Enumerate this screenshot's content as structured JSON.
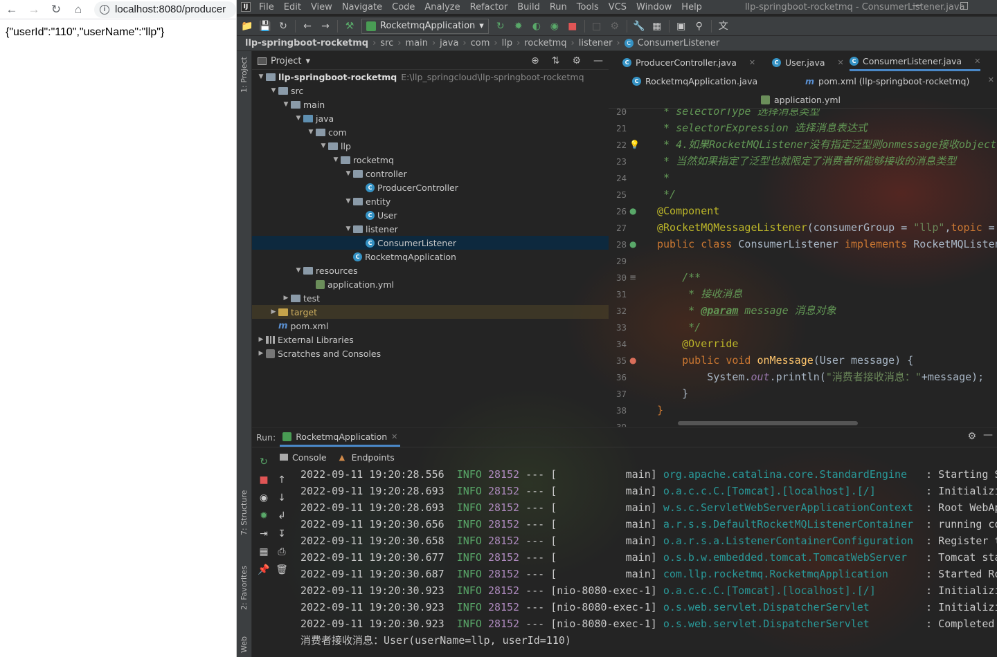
{
  "browser": {
    "url": "localhost:8080/producer",
    "body": "{\"userId\":\"110\",\"userName\":\"llp\"}"
  },
  "ide": {
    "window_title": "llp-springboot-rocketmq - ConsumerListener.java",
    "menu": [
      "File",
      "Edit",
      "View",
      "Navigate",
      "Code",
      "Analyze",
      "Refactor",
      "Build",
      "Run",
      "Tools",
      "VCS",
      "Window",
      "Help"
    ],
    "run_config": "RocketmqApplication",
    "breadcrumbs": [
      "llp-springboot-rocketmq",
      "src",
      "main",
      "java",
      "com",
      "llp",
      "rocketmq",
      "listener",
      "ConsumerListener"
    ],
    "side_labels": {
      "project": "1: Project",
      "structure": "7: Structure",
      "favorites": "2: Favorites",
      "web": "Web"
    },
    "project_panel": {
      "title": "Project",
      "root_path": "E:\\llp_springcloud\\llp-springboot-rocketmq",
      "tree": [
        {
          "label": "llp-springboot-rocketmq",
          "depth": 0,
          "type": "module",
          "expanded": true
        },
        {
          "label": "src",
          "depth": 1,
          "type": "folder",
          "expanded": true
        },
        {
          "label": "main",
          "depth": 2,
          "type": "folder",
          "expanded": true
        },
        {
          "label": "java",
          "depth": 3,
          "type": "srcfolder",
          "expanded": true
        },
        {
          "label": "com",
          "depth": 4,
          "type": "folder",
          "expanded": true
        },
        {
          "label": "llp",
          "depth": 5,
          "type": "folder",
          "expanded": true
        },
        {
          "label": "rocketmq",
          "depth": 6,
          "type": "folder",
          "expanded": true
        },
        {
          "label": "controller",
          "depth": 7,
          "type": "folder",
          "expanded": true
        },
        {
          "label": "ProducerController",
          "depth": 8,
          "type": "class"
        },
        {
          "label": "entity",
          "depth": 7,
          "type": "folder",
          "expanded": true
        },
        {
          "label": "User",
          "depth": 8,
          "type": "class"
        },
        {
          "label": "listener",
          "depth": 7,
          "type": "folder",
          "expanded": true
        },
        {
          "label": "ConsumerListener",
          "depth": 8,
          "type": "class",
          "selected": true
        },
        {
          "label": "RocketmqApplication",
          "depth": 7,
          "type": "appclass"
        },
        {
          "label": "resources",
          "depth": 3,
          "type": "resfolder",
          "expanded": true
        },
        {
          "label": "application.yml",
          "depth": 4,
          "type": "yml"
        },
        {
          "label": "test",
          "depth": 2,
          "type": "folder",
          "expanded": false
        },
        {
          "label": "target",
          "depth": 1,
          "type": "target",
          "expanded": false,
          "highlight": true
        },
        {
          "label": "pom.xml",
          "depth": 1,
          "type": "maven"
        },
        {
          "label": "External Libraries",
          "depth": 0,
          "type": "lib",
          "expanded": false
        },
        {
          "label": "Scratches and Consoles",
          "depth": 0,
          "type": "scratch",
          "expanded": false
        }
      ]
    },
    "tabs": [
      {
        "label": "ProducerController.java",
        "icon": "class"
      },
      {
        "label": "User.java",
        "icon": "class"
      },
      {
        "label": "ConsumerListener.java",
        "icon": "class",
        "active": true
      },
      {
        "label": "RocketmqApplication.java",
        "icon": "class"
      },
      {
        "label": "pom.xml (llp-springboot-rocketmq)",
        "icon": "maven"
      },
      {
        "label": "application.yml",
        "icon": "yml"
      }
    ],
    "editor": {
      "line_numbers": [
        "20",
        "21",
        "22",
        "23",
        "24",
        "25",
        "26",
        "27",
        "28",
        "29",
        "30",
        "31",
        "32",
        "33",
        "34",
        "35",
        "36",
        "37",
        "38",
        "39"
      ],
      "lines": [
        {
          "t": "c",
          "parts": [
            [
              "cm",
              " * selectorType 选择消息类型"
            ]
          ]
        },
        {
          "t": "c",
          "parts": [
            [
              "cm",
              " * selectorExpression 选择消息表达式"
            ]
          ]
        },
        {
          "t": "c",
          "parts": [
            [
              "cm",
              " * 4.如果RocketMQListener没有指定泛型则onmessage接收object"
            ]
          ]
        },
        {
          "t": "c",
          "parts": [
            [
              "cm",
              " * 当然如果指定了泛型也就限定了消费者所能够接收的消息类型"
            ]
          ]
        },
        {
          "t": "c",
          "parts": [
            [
              "cm",
              " *"
            ]
          ]
        },
        {
          "t": "c",
          "parts": [
            [
              "cm",
              " */"
            ]
          ]
        },
        {
          "t": "c",
          "parts": [
            [
              "ann",
              "@Component"
            ]
          ]
        },
        {
          "t": "c",
          "parts": [
            [
              "ann",
              "@RocketMQMessageListener"
            ],
            [
              "",
              "(consumerGroup = "
            ],
            [
              "str",
              "\"llp\""
            ],
            [
              "",
              ","
            ],
            [
              "kw",
              "topic"
            ],
            [
              "",
              " ="
            ]
          ]
        },
        {
          "t": "c",
          "parts": [
            [
              "kw",
              "public class "
            ],
            [
              "",
              "ConsumerListener "
            ],
            [
              "kw",
              "implements "
            ],
            [
              "",
              "RocketMQListen"
            ]
          ]
        },
        {
          "t": "c",
          "parts": [
            [
              "",
              ""
            ]
          ]
        },
        {
          "t": "c",
          "parts": [
            [
              "cm",
              "    /**"
            ]
          ]
        },
        {
          "t": "c",
          "parts": [
            [
              "cm",
              "     * 接收消息"
            ]
          ]
        },
        {
          "t": "c",
          "parts": [
            [
              "cm",
              "     * "
            ],
            [
              "tag",
              "@param"
            ],
            [
              "cm",
              " message 消息对象"
            ]
          ]
        },
        {
          "t": "c",
          "parts": [
            [
              "cm",
              "     */"
            ]
          ]
        },
        {
          "t": "c",
          "parts": [
            [
              "ann",
              "    @Override"
            ]
          ]
        },
        {
          "t": "c",
          "parts": [
            [
              "kw",
              "    public void "
            ],
            [
              "fn",
              "onMessage"
            ],
            [
              "",
              "(User message) {"
            ]
          ]
        },
        {
          "t": "c",
          "parts": [
            [
              "",
              "        System."
            ],
            [
              "st",
              "out"
            ],
            [
              "",
              ".println("
            ],
            [
              "str",
              "\"消费者接收消息：\""
            ],
            [
              "",
              "+message);"
            ]
          ]
        },
        {
          "t": "c",
          "parts": [
            [
              "",
              "    }"
            ]
          ]
        },
        {
          "t": "c",
          "parts": [
            [
              "kw",
              "}"
            ]
          ]
        },
        {
          "t": "c",
          "parts": [
            [
              "",
              ""
            ]
          ]
        }
      ]
    },
    "run": {
      "label": "Run:",
      "tab": "RocketmqApplication",
      "subtabs": [
        "Console",
        "Endpoints"
      ],
      "logs": [
        {
          "ts": "2022-09-11 19:20:28.556",
          "lvl": "INFO",
          "pid": "28152",
          "sep": "---",
          "thread": "[           main]",
          "cls": "org.apache.catalina.core.StandardEngine  ",
          "msg": ": Starting Se"
        },
        {
          "ts": "2022-09-11 19:20:28.693",
          "lvl": "INFO",
          "pid": "28152",
          "sep": "---",
          "thread": "[           main]",
          "cls": "o.a.c.c.C.[Tomcat].[localhost].[/]       ",
          "msg": ": Initializin"
        },
        {
          "ts": "2022-09-11 19:20:28.693",
          "lvl": "INFO",
          "pid": "28152",
          "sep": "---",
          "thread": "[           main]",
          "cls": "w.s.c.ServletWebServerApplicationContext ",
          "msg": ": Root WebApp"
        },
        {
          "ts": "2022-09-11 19:20:30.656",
          "lvl": "INFO",
          "pid": "28152",
          "sep": "---",
          "thread": "[           main]",
          "cls": "a.r.s.s.DefaultRocketMQListenerContainer ",
          "msg": ": running con"
        },
        {
          "ts": "2022-09-11 19:20:30.658",
          "lvl": "INFO",
          "pid": "28152",
          "sep": "---",
          "thread": "[           main]",
          "cls": "o.a.r.s.a.ListenerContainerConfiguration ",
          "msg": ": Register th"
        },
        {
          "ts": "2022-09-11 19:20:30.677",
          "lvl": "INFO",
          "pid": "28152",
          "sep": "---",
          "thread": "[           main]",
          "cls": "o.s.b.w.embedded.tomcat.TomcatWebServer  ",
          "msg": ": Tomcat star"
        },
        {
          "ts": "2022-09-11 19:20:30.687",
          "lvl": "INFO",
          "pid": "28152",
          "sep": "---",
          "thread": "[           main]",
          "cls": "com.llp.rocketmq.RocketmqApplication     ",
          "msg": ": Started Roc"
        },
        {
          "ts": "2022-09-11 19:20:30.923",
          "lvl": "INFO",
          "pid": "28152",
          "sep": "---",
          "thread": "[nio-8080-exec-1]",
          "cls": "o.a.c.c.C.[Tomcat].[localhost].[/]       ",
          "msg": ": Initializin"
        },
        {
          "ts": "2022-09-11 19:20:30.923",
          "lvl": "INFO",
          "pid": "28152",
          "sep": "---",
          "thread": "[nio-8080-exec-1]",
          "cls": "o.s.web.servlet.DispatcherServlet        ",
          "msg": ": Initializin"
        },
        {
          "ts": "2022-09-11 19:20:30.923",
          "lvl": "INFO",
          "pid": "28152",
          "sep": "---",
          "thread": "[nio-8080-exec-1]",
          "cls": "o.s.web.servlet.DispatcherServlet        ",
          "msg": ": Completed i"
        }
      ],
      "output": "消费者接收消息：User(userName=llp, userId=110)"
    }
  }
}
